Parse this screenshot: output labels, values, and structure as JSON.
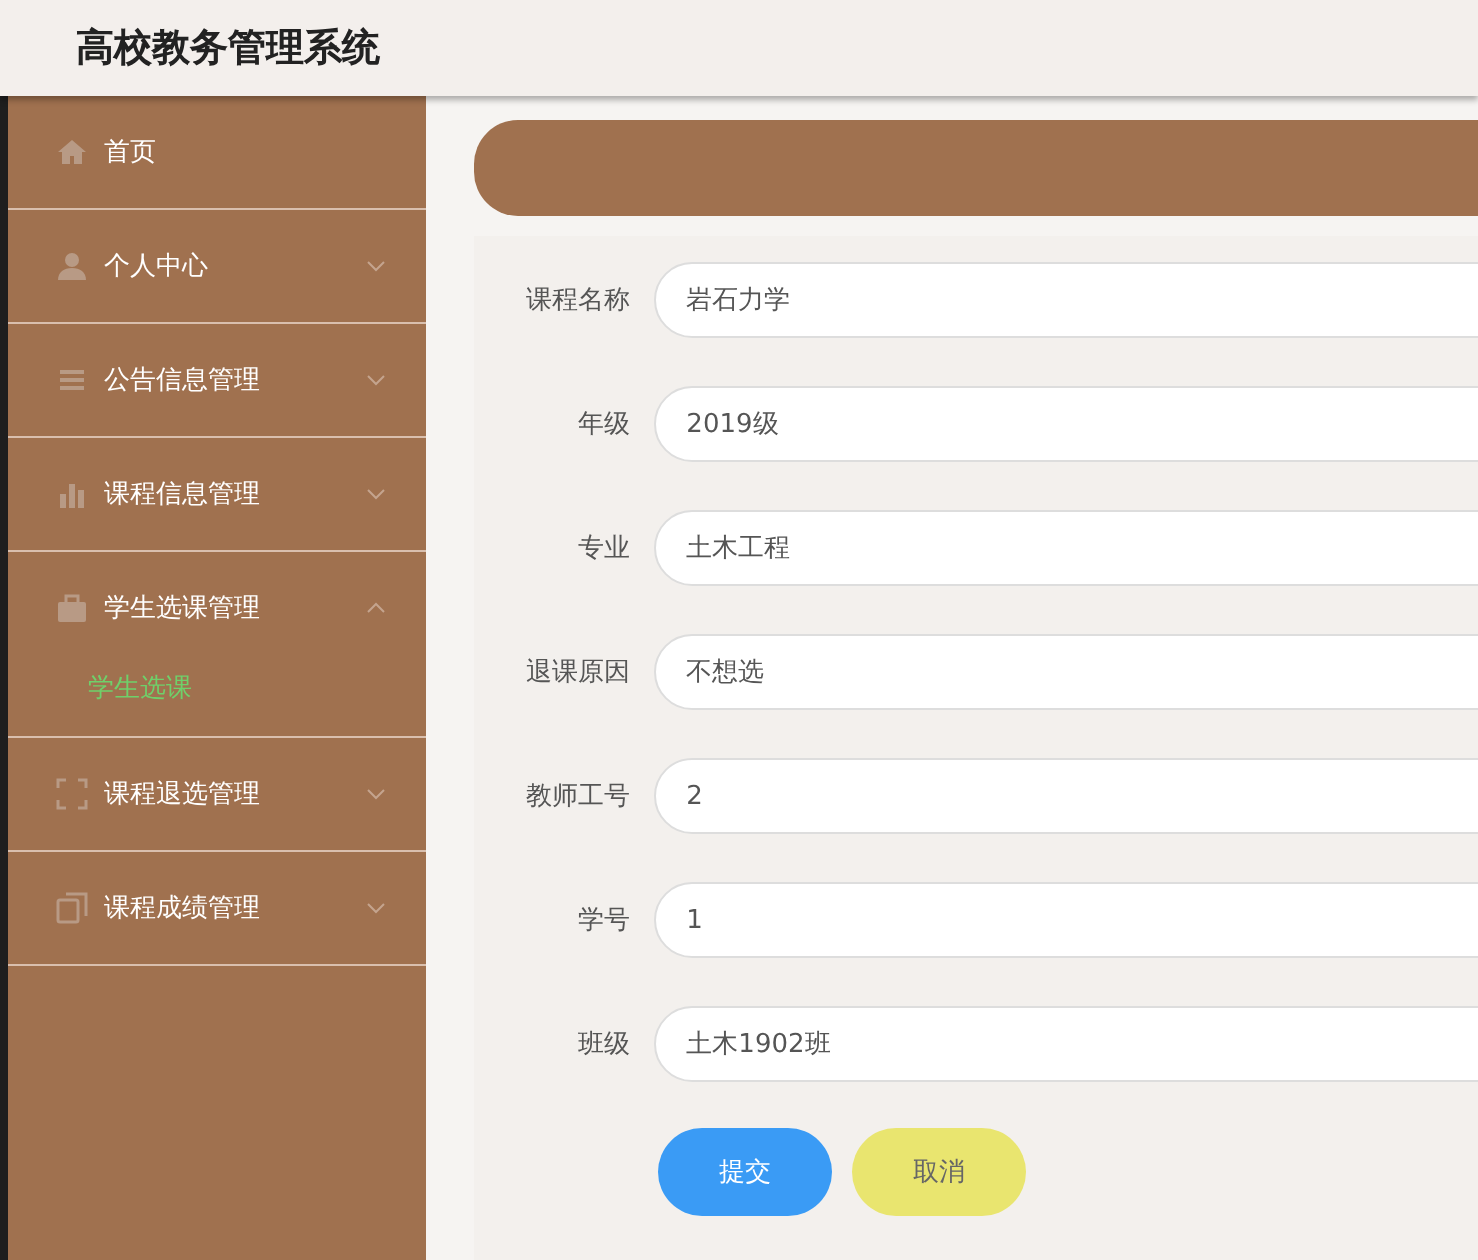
{
  "header": {
    "title": "高校教务管理系统"
  },
  "sidebar": {
    "items": [
      {
        "label": "首页"
      },
      {
        "label": "个人中心",
        "expanded": false
      },
      {
        "label": "公告信息管理",
        "expanded": false
      },
      {
        "label": "课程信息管理",
        "expanded": false
      },
      {
        "label": "学生选课管理",
        "expanded": true,
        "children": [
          {
            "label": "学生选课",
            "selected": true
          }
        ]
      },
      {
        "label": "课程退选管理",
        "expanded": false
      },
      {
        "label": "课程成绩管理",
        "expanded": false
      }
    ]
  },
  "form": {
    "fields": [
      {
        "label": "课程名称",
        "value": "岩石力学"
      },
      {
        "label": "年级",
        "value": "2019级"
      },
      {
        "label": "专业",
        "value": "土木工程"
      },
      {
        "label": "退课原因",
        "value": "不想选"
      },
      {
        "label": "教师工号",
        "value": "2"
      },
      {
        "label": "学号",
        "value": "1"
      },
      {
        "label": "班级",
        "value": "土木1902班"
      }
    ],
    "buttons": [
      {
        "label": "提交",
        "kind": "primary"
      },
      {
        "label": "取消",
        "kind": "cancel"
      }
    ]
  }
}
